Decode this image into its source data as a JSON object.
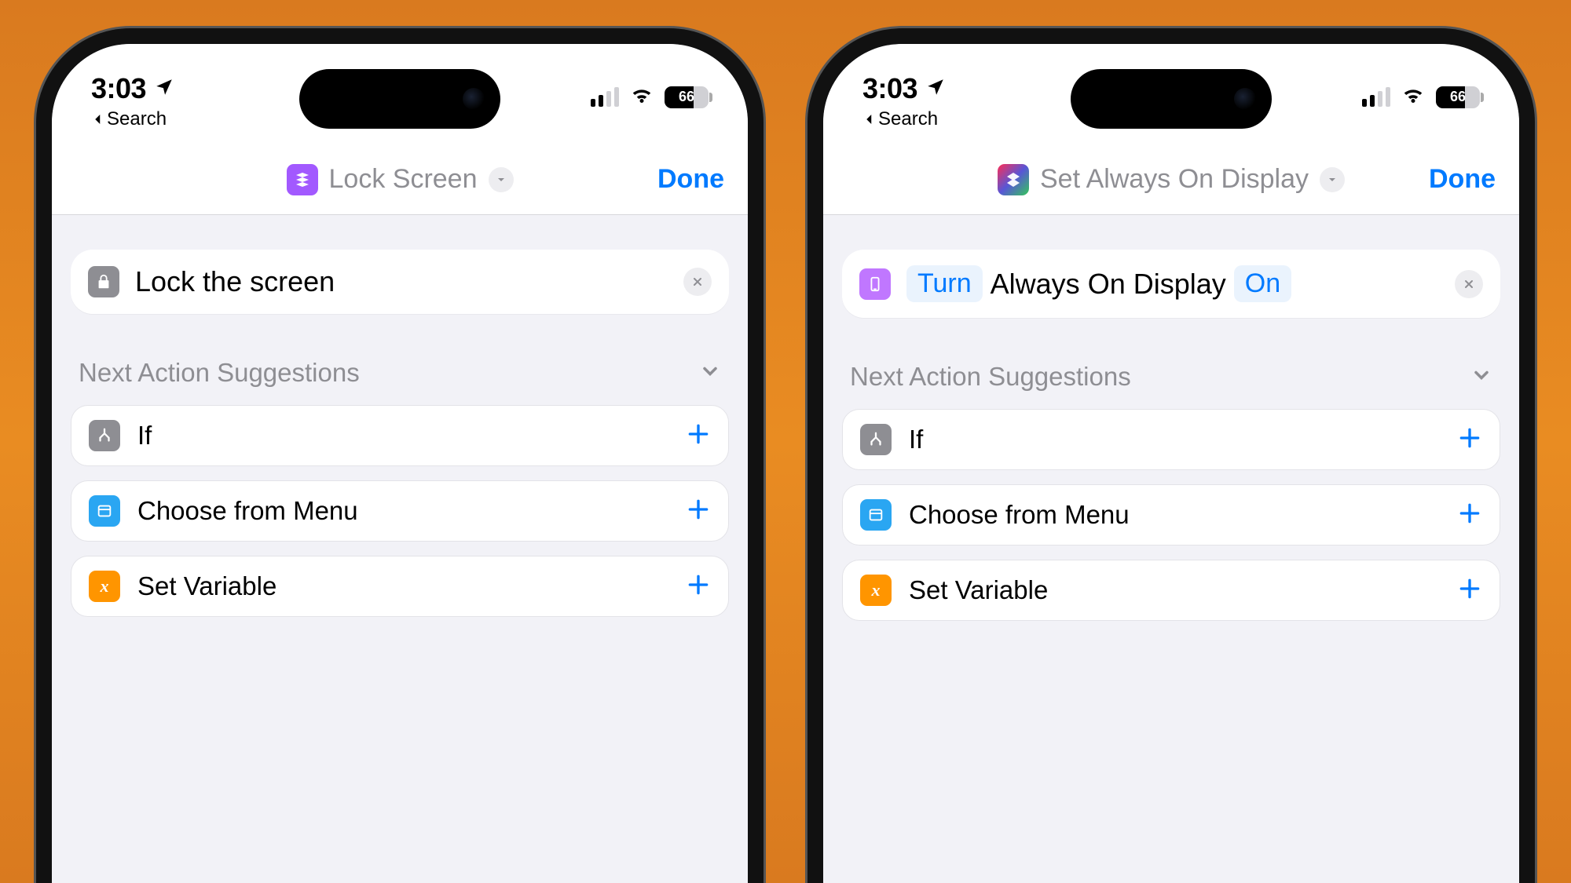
{
  "status": {
    "time": "3:03",
    "back_label": "Search",
    "battery_percent": "66",
    "battery_fill_css": "66%"
  },
  "phones": [
    {
      "nav": {
        "title": "Lock Screen",
        "done": "Done",
        "icon": "layers"
      },
      "action": {
        "kind": "simple",
        "text": "Lock the screen"
      },
      "suggestions_header": "Next Action Suggestions",
      "suggestions": [
        {
          "label": "If",
          "icon": "branch",
          "color": "gray"
        },
        {
          "label": "Choose from Menu",
          "icon": "menu",
          "color": "blue"
        },
        {
          "label": "Set Variable",
          "icon": "var",
          "color": "orange"
        }
      ]
    },
    {
      "nav": {
        "title": "Set Always On Display",
        "done": "Done",
        "icon": "shortcuts"
      },
      "action": {
        "kind": "aod",
        "token_1": "Turn",
        "plain": "Always On Display",
        "token_2": "On"
      },
      "suggestions_header": "Next Action Suggestions",
      "suggestions": [
        {
          "label": "If",
          "icon": "branch",
          "color": "gray"
        },
        {
          "label": "Choose from Menu",
          "icon": "menu",
          "color": "blue"
        },
        {
          "label": "Set Variable",
          "icon": "var",
          "color": "orange"
        }
      ]
    }
  ]
}
